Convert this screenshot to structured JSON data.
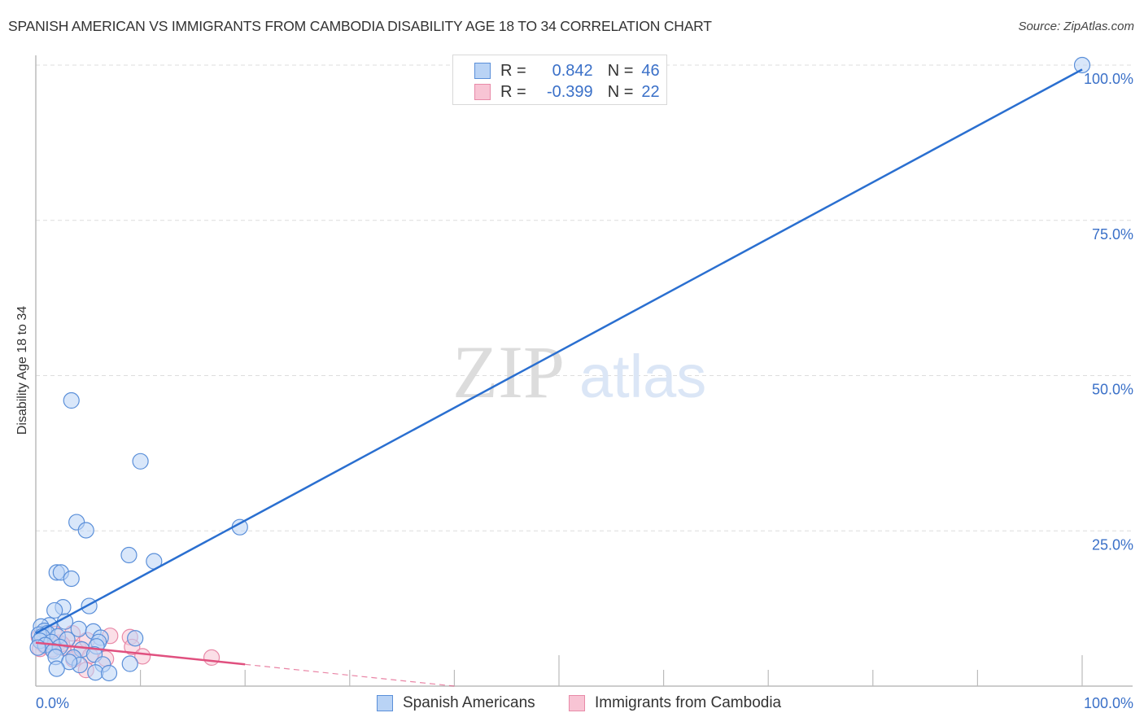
{
  "title": "SPANISH AMERICAN VS IMMIGRANTS FROM CAMBODIA DISABILITY AGE 18 TO 34 CORRELATION CHART",
  "source": "Source: ZipAtlas.com",
  "watermark": {
    "zip": "ZIP",
    "atlas": "atlas"
  },
  "legend_top": [
    {
      "r_label": "R =",
      "r_value": "0.842",
      "n_label": "N =",
      "n_value": "46"
    },
    {
      "r_label": "R =",
      "r_value": "-0.399",
      "n_label": "N =",
      "n_value": "22"
    }
  ],
  "legend_bottom": [
    "Spanish Americans",
    "Immigrants from Cambodia"
  ],
  "colors": {
    "blue_fill": "#b9d3f5",
    "blue_stroke": "#5a8fd9",
    "blue_line": "#2a6fd0",
    "pink_fill": "#f8c4d4",
    "pink_stroke": "#e88aa8",
    "pink_line": "#e0507f",
    "tick_label": "#3a70c8",
    "grid": "#dddddd",
    "axis": "#bbbbbb"
  },
  "chart_data": {
    "type": "scatter",
    "title": "SPANISH AMERICAN VS IMMIGRANTS FROM CAMBODIA DISABILITY AGE 18 TO 34 CORRELATION CHART",
    "xlabel": "",
    "ylabel": "Disability Age 18 to 34",
    "xlim": [
      0,
      100
    ],
    "ylim": [
      0,
      100
    ],
    "x_tick_labels": [
      "0.0%",
      "100.0%"
    ],
    "y_ticks": [
      25,
      50,
      75,
      100
    ],
    "y_tick_labels": [
      "25.0%",
      "50.0%",
      "75.0%",
      "100.0%"
    ],
    "grid": true,
    "legend_position": "top-center",
    "series": [
      {
        "name": "Spanish Americans",
        "r": 0.842,
        "n": 46,
        "trend": {
          "x": [
            0,
            100
          ],
          "y": [
            8.5,
            99.3
          ],
          "dashed_from": null
        },
        "points": [
          [
            100,
            100
          ],
          [
            3.4,
            46
          ],
          [
            10,
            36.2
          ],
          [
            19.5,
            25.6
          ],
          [
            3.9,
            26.4
          ],
          [
            4.8,
            25.1
          ],
          [
            8.9,
            21.1
          ],
          [
            11.3,
            20.1
          ],
          [
            2.0,
            18.3
          ],
          [
            2.4,
            18.3
          ],
          [
            3.4,
            17.3
          ],
          [
            5.1,
            12.9
          ],
          [
            2.6,
            12.7
          ],
          [
            1.8,
            12.2
          ],
          [
            2.8,
            10.4
          ],
          [
            1.3,
            9.8
          ],
          [
            0.5,
            9.6
          ],
          [
            4.1,
            9.2
          ],
          [
            0.8,
            8.9
          ],
          [
            1.1,
            8.5
          ],
          [
            0.3,
            8.3
          ],
          [
            0.6,
            8.0
          ],
          [
            2.1,
            8.0
          ],
          [
            5.5,
            8.8
          ],
          [
            6.2,
            7.8
          ],
          [
            9.5,
            7.7
          ],
          [
            0.4,
            7.3
          ],
          [
            1.5,
            7.1
          ],
          [
            3.0,
            7.5
          ],
          [
            6.0,
            7.1
          ],
          [
            0.9,
            6.6
          ],
          [
            0.2,
            6.2
          ],
          [
            2.3,
            6.3
          ],
          [
            5.8,
            6.4
          ],
          [
            1.7,
            5.6
          ],
          [
            4.4,
            5.9
          ],
          [
            5.6,
            5.1
          ],
          [
            1.9,
            4.7
          ],
          [
            3.6,
            4.6
          ],
          [
            6.4,
            3.5
          ],
          [
            4.2,
            3.4
          ],
          [
            3.2,
            3.9
          ],
          [
            9.0,
            3.6
          ],
          [
            2.0,
            2.8
          ],
          [
            5.7,
            2.2
          ],
          [
            7.0,
            2.1
          ]
        ]
      },
      {
        "name": "Immigrants from Cambodia",
        "r": -0.399,
        "n": 22,
        "trend": {
          "x": [
            0,
            40
          ],
          "y": [
            7.0,
            0
          ],
          "dashed_from": 20
        },
        "points": [
          [
            0.3,
            7.9
          ],
          [
            0.6,
            6.9
          ],
          [
            0.9,
            6.4
          ],
          [
            1.2,
            7.3
          ],
          [
            1.6,
            5.9
          ],
          [
            2.2,
            7.0
          ],
          [
            2.6,
            6.2
          ],
          [
            3.5,
            8.5
          ],
          [
            4.1,
            6.1
          ],
          [
            4.9,
            7.4
          ],
          [
            3.6,
            4.3
          ],
          [
            5.2,
            4.9
          ],
          [
            6.7,
            4.4
          ],
          [
            7.1,
            8.1
          ],
          [
            9.0,
            7.9
          ],
          [
            2.5,
            6.8
          ],
          [
            9.2,
            6.3
          ],
          [
            10.2,
            4.8
          ],
          [
            16.8,
            4.6
          ],
          [
            4.8,
            2.6
          ],
          [
            0.4,
            6.0
          ],
          [
            1.8,
            8.4
          ]
        ]
      }
    ]
  }
}
